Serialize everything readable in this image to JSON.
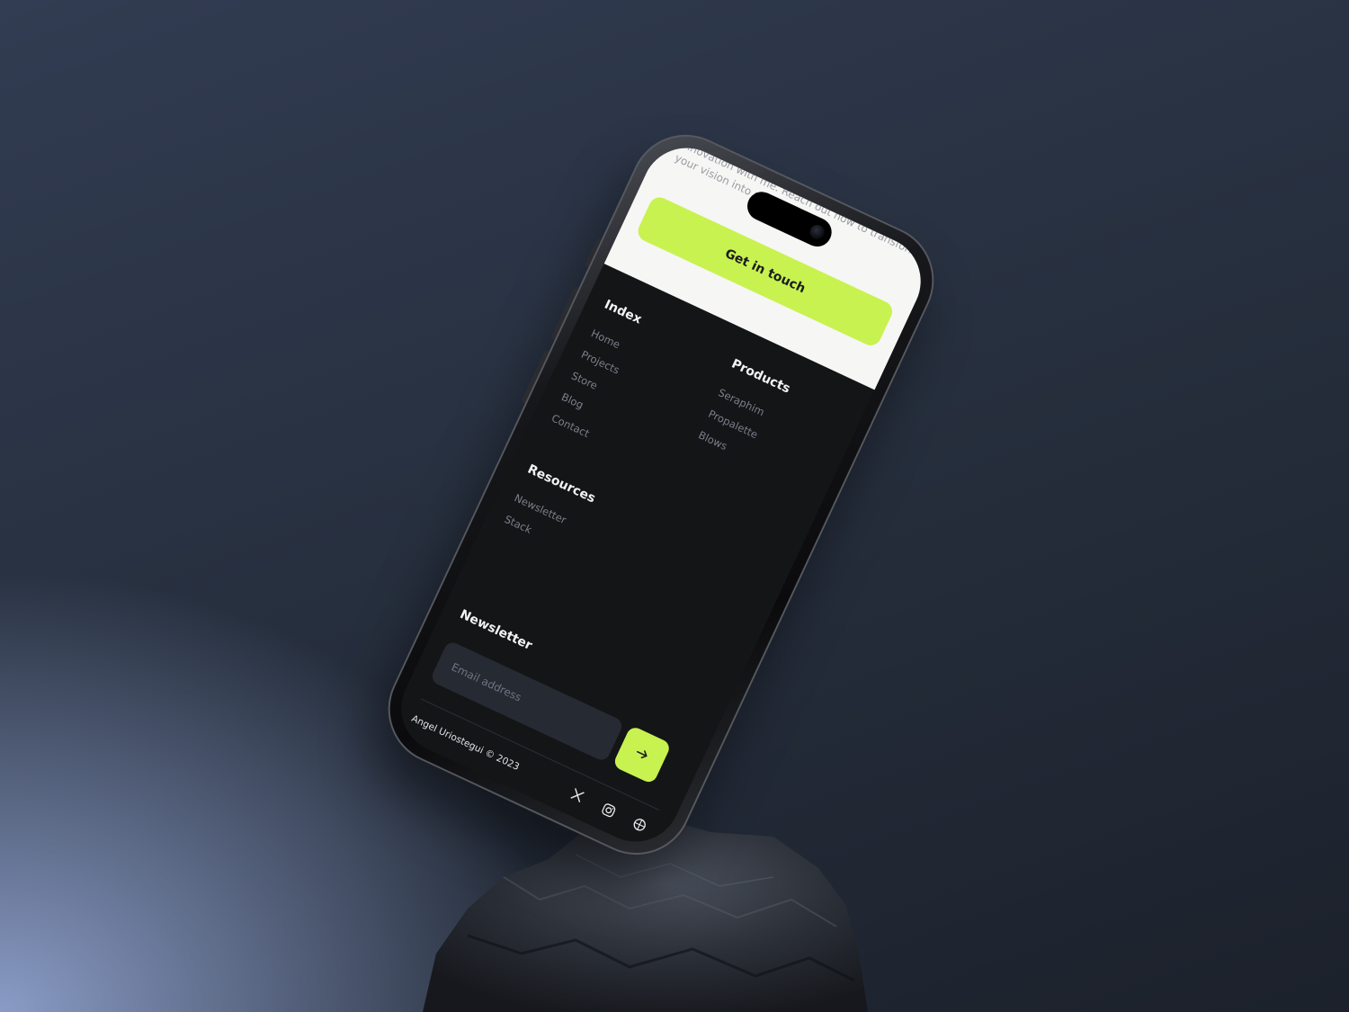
{
  "cta": {
    "text": "innovation with me. Reach out now to transform your vision into reality.",
    "button_label": "Get in touch"
  },
  "footer": {
    "index": {
      "title": "Index",
      "links": [
        "Home",
        "Projects",
        "Store",
        "Blog",
        "Contact"
      ]
    },
    "products": {
      "title": "Products",
      "links": [
        "Seraphim",
        "Propalette",
        "Blows"
      ]
    },
    "resources": {
      "title": "Resources",
      "links": [
        "Newsletter",
        "Stack"
      ]
    },
    "newsletter": {
      "title": "Newsletter",
      "email_placeholder": "Email address",
      "submit_icon": "arrow-right-icon"
    },
    "copyright": "Angel Uriostegui © 2023",
    "socials": [
      "x-icon",
      "instagram-icon",
      "dribbble-icon"
    ]
  },
  "colors": {
    "accent": "#c8f250",
    "footer_bg": "#141517",
    "cta_bg": "#f6f6f4",
    "input_bg": "#262a33"
  }
}
